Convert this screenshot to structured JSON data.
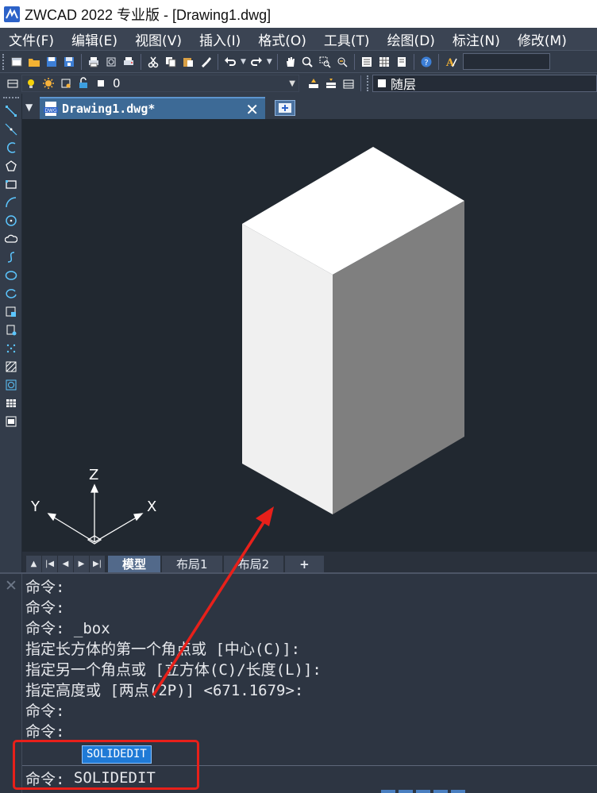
{
  "window": {
    "title": "ZWCAD 2022 专业版 - [Drawing1.dwg]"
  },
  "menubar": {
    "items": [
      "文件(F)",
      "编辑(E)",
      "视图(V)",
      "插入(I)",
      "格式(O)",
      "工具(T)",
      "绘图(D)",
      "标注(N)",
      "修改(M)"
    ]
  },
  "toolbar1": {
    "icons": [
      "new-icon",
      "open-icon",
      "save-icon",
      "save-as-icon",
      "print-icon",
      "print-preview-icon",
      "plot-icon",
      "cut-icon",
      "copy-icon",
      "paste-icon",
      "match-properties-icon",
      "undo-icon",
      "redo-icon",
      "pan-icon",
      "zoom-realtime-icon",
      "zoom-window-icon",
      "zoom-previous-icon",
      "properties-icon",
      "design-center-icon",
      "tool-palettes-icon",
      "help-icon",
      "text-style-icon"
    ]
  },
  "toolbar2": {
    "layer_name": "0",
    "color_value": "随层",
    "icons": [
      "layer-manager-icon",
      "layer-on-icon",
      "layer-freeze-icon",
      "layer-lock-icon",
      "make-current-icon",
      "layer-previous-icon",
      "layer-states-icon"
    ]
  },
  "left_toolbar": {
    "icons": [
      "line-icon",
      "construction-line-icon",
      "polyline-icon",
      "polygon-icon",
      "rectangle-icon",
      "arc-icon",
      "circle-icon",
      "revision-cloud-icon",
      "spline-icon",
      "ellipse-icon",
      "ellipse-arc-icon",
      "insert-block-icon",
      "make-block-icon",
      "point-icon",
      "hatch-icon",
      "region-icon",
      "table-icon",
      "mtext-icon"
    ]
  },
  "doc_tab": {
    "title": "Drawing1.dwg*",
    "close": "✕"
  },
  "ucs": {
    "x_label": "X",
    "y_label": "Y",
    "z_label": "Z"
  },
  "layout_tabs": {
    "nav": [
      "▲",
      "|◀",
      "◀",
      "▶",
      "▶|"
    ],
    "tabs": [
      "模型",
      "布局1",
      "布局2"
    ],
    "add": "+"
  },
  "command": {
    "history": [
      "命令:",
      "命令:",
      "命令: _box",
      "指定长方体的第一个角点或 [中心(C)]:",
      "指定另一个角点或 [立方体(C)/长度(L)]:",
      "指定高度或 [两点(2P)] <671.1679>:",
      "命令:",
      "命令:"
    ],
    "autocomplete": "SOLIDEDIT",
    "prompt": "命令: ",
    "input_value": "SOLIDEDIT"
  },
  "colors": {
    "menubar_bg": "#3b4453",
    "canvas_bg": "#212830",
    "box_top": "#ffffff",
    "box_left": "#f0f0f0",
    "box_right": "#7f7f7f",
    "annotation": "#e8201a",
    "tab_active": "#3d6a96",
    "autocomplete_bg": "#1f7ad6"
  }
}
